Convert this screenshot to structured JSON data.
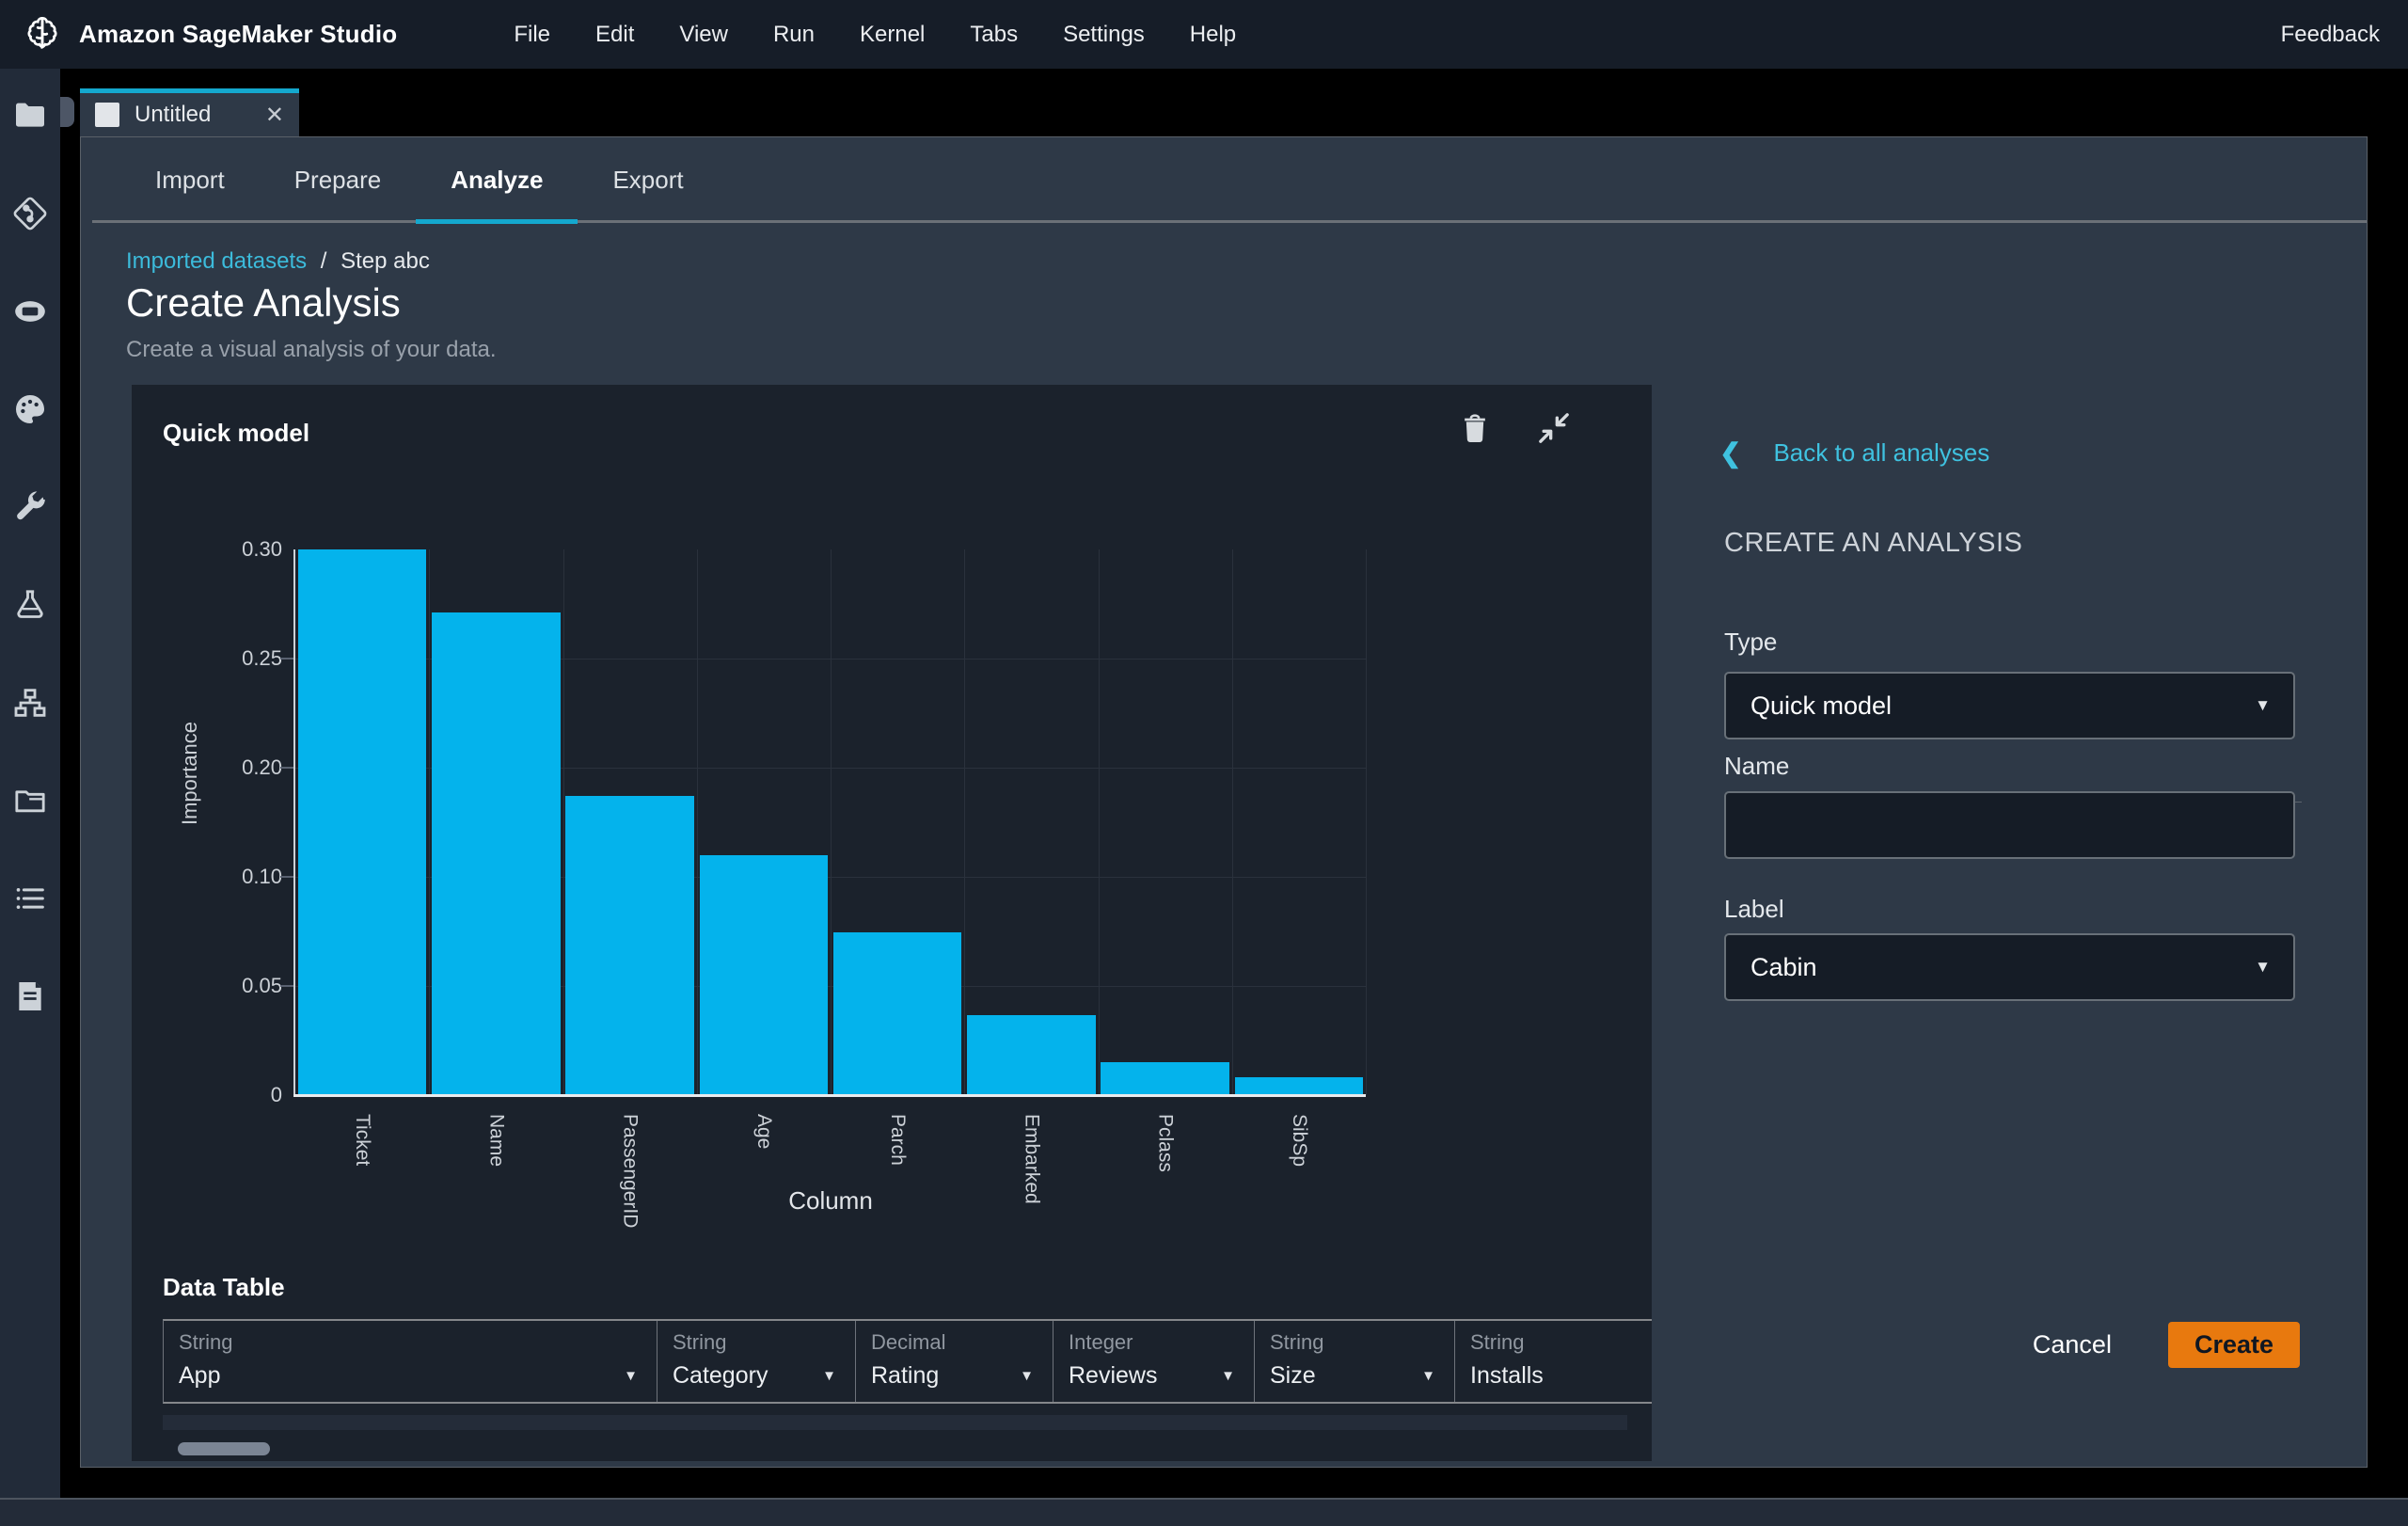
{
  "topbar": {
    "logo_title": "Amazon SageMaker Studio",
    "menu": [
      "File",
      "Edit",
      "View",
      "Run",
      "Kernel",
      "Tabs",
      "Settings",
      "Help"
    ],
    "feedback": "Feedback"
  },
  "sidebar": {
    "icons": [
      "folder-icon",
      "git-icon",
      "terminal-icon",
      "palette-icon",
      "wrench-icon",
      "flask-icon",
      "network-icon",
      "open-folder-icon",
      "list-icon",
      "document-icon"
    ]
  },
  "doc_tab": {
    "title": "Untitled",
    "close": "✕"
  },
  "section_tabs": [
    {
      "label": "Import",
      "active": false
    },
    {
      "label": "Prepare",
      "active": false
    },
    {
      "label": "Analyze",
      "active": true
    },
    {
      "label": "Export",
      "active": false
    }
  ],
  "breadcrumb": {
    "link": "Imported datasets",
    "separator": "/",
    "current": "Step abc"
  },
  "page": {
    "title": "Create Analysis",
    "subtitle": "Create a visual analysis of your data."
  },
  "panel": {
    "title": "Quick model"
  },
  "chart_data": {
    "type": "bar",
    "title": "Quick model",
    "xlabel": "Column",
    "ylabel": "Importance",
    "categories": [
      "Ticket",
      "Name",
      "PassengerID",
      "Age",
      "Parch",
      "Embarked",
      "Pclass",
      "SibSp"
    ],
    "values": [
      0.3,
      0.27,
      0.17,
      0.12,
      0.07,
      0.036,
      0.015,
      0.01
    ],
    "bar_fractions": [
      1.0,
      0.885,
      0.549,
      0.439,
      0.298,
      0.146,
      0.06,
      0.033
    ],
    "ytick_labels": [
      "0.30",
      "0.25",
      "0.20",
      "0.10",
      "0.05",
      "0"
    ],
    "axis_note": "tick labels evenly spaced as rendered in source; 0.15 label absent",
    "bar_color": "#04b3ec",
    "grid": true,
    "legend": false
  },
  "data_table": {
    "title": "Data Table",
    "columns": [
      {
        "type": "String",
        "name": "App",
        "caret": true
      },
      {
        "type": "String",
        "name": "Category",
        "caret": true
      },
      {
        "type": "Decimal",
        "name": "Rating",
        "caret": true
      },
      {
        "type": "Integer",
        "name": "Reviews",
        "caret": true
      },
      {
        "type": "String",
        "name": "Size",
        "caret": true
      },
      {
        "type": "String",
        "name": "Installs",
        "caret": false
      }
    ]
  },
  "inspector": {
    "back": "Back to all analyses",
    "back_chevron": "❮",
    "heading": "CREATE AN ANALYSIS",
    "type_label": "Type",
    "type_value": "Quick model",
    "name_label": "Name",
    "name_value": "",
    "label_label": "Label",
    "label_value": "Cabin",
    "cancel": "Cancel",
    "create": "Create",
    "caret": "▼"
  },
  "colors": {
    "accent_cyan": "#14a8ce",
    "link_cyan": "#3cbbdb",
    "bar_cyan": "#04b3ec",
    "create_orange": "#e8790e",
    "window_bg": "#2e3947",
    "card_bg": "#1b222c",
    "topbar_bg": "#161d28"
  }
}
